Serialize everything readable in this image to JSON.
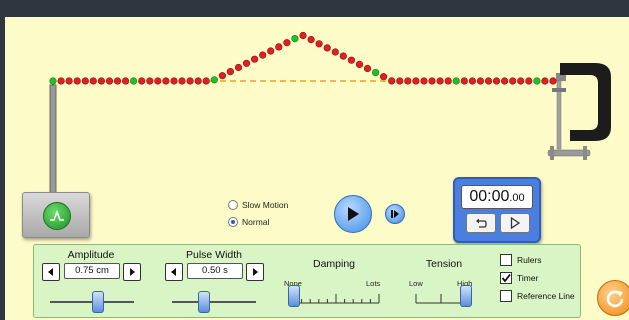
{
  "speed": {
    "options": [
      "Slow Motion",
      "Normal"
    ],
    "selected": "Normal"
  },
  "timer": {
    "display": "00:00",
    "display_small": ".00"
  },
  "controls": {
    "amplitude": {
      "label": "Amplitude",
      "value": "0.75 cm"
    },
    "pulse_width": {
      "label": "Pulse Width",
      "value": "0.50 s"
    },
    "damping": {
      "label": "Damping",
      "min_label": "None",
      "max_label": "Lots"
    },
    "tension": {
      "label": "Tension",
      "min_label": "Low",
      "max_label": "High"
    }
  },
  "options": {
    "rulers": {
      "label": "Rulers",
      "checked": false
    },
    "timer": {
      "label": "Timer",
      "checked": true
    },
    "reference_line": {
      "label": "Reference Line",
      "checked": false
    }
  },
  "icons": {
    "pulse": "pulse-icon",
    "play": "play-icon",
    "step": "step-icon",
    "timer_reset": "undo-icon",
    "timer_play": "play-icon",
    "reset_all": "reset-icon",
    "clamp": "clamp-icon"
  },
  "colors": {
    "stage_background": "#fdfbc8",
    "bead_red": "#e02020",
    "bead_green": "#22c02a",
    "reference_dash": "#f0a020",
    "panel_background": "#d9f5c6",
    "timer_blue": "#4a7fe0",
    "reset_orange": "#f08a14"
  }
}
